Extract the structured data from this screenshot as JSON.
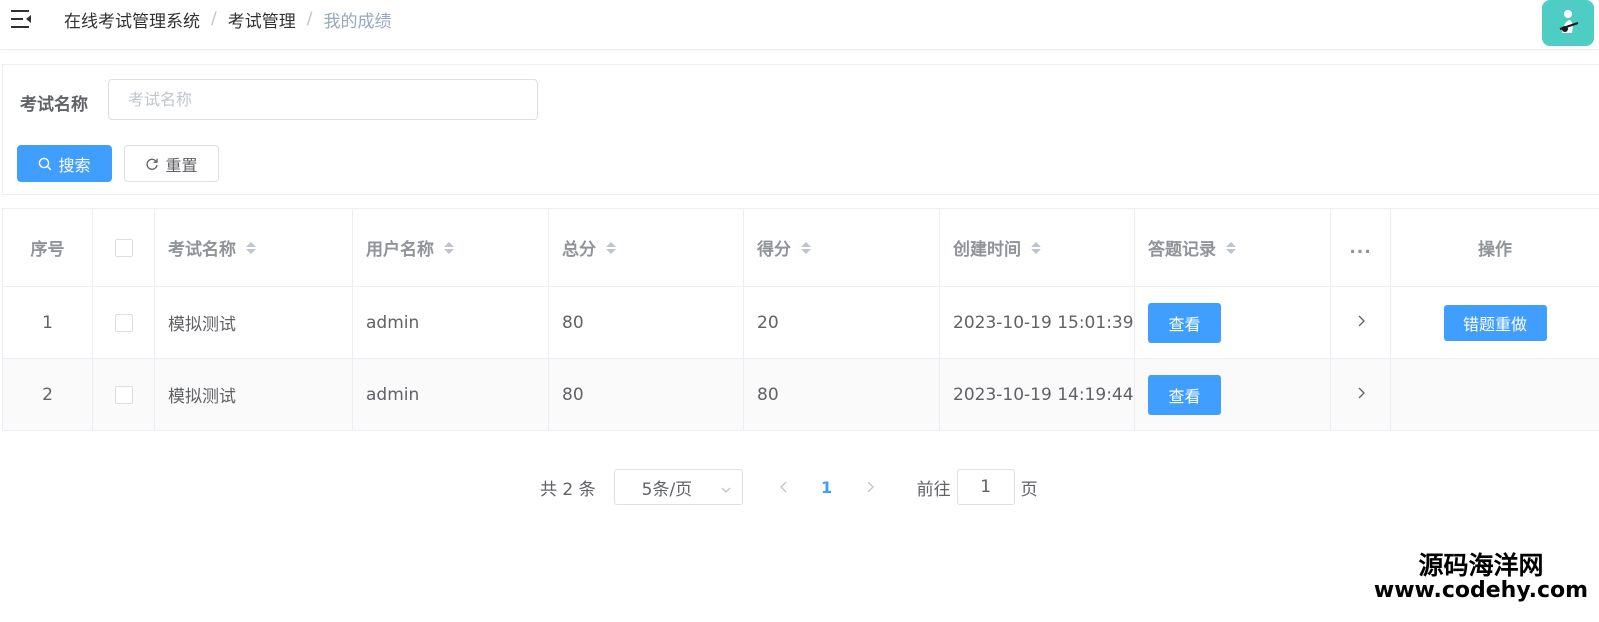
{
  "header": {
    "breadcrumb": [
      "在线考试管理系统",
      "考试管理",
      "我的成绩"
    ],
    "separator": "/"
  },
  "search": {
    "label": "考试名称",
    "placeholder": "考试名称",
    "value": "",
    "search_button": "搜索",
    "reset_button": "重置"
  },
  "table": {
    "columns": [
      "序号",
      "考试名称",
      "用户名称",
      "总分",
      "得分",
      "创建时间",
      "答题记录",
      "...",
      "操作"
    ],
    "rows": [
      {
        "index": "1",
        "exam_name": "模拟测试",
        "user_name": "admin",
        "total": "80",
        "score": "20",
        "created": "2023-10-19 15:01:39",
        "record_button": "查看",
        "action_button": "错题重做"
      },
      {
        "index": "2",
        "exam_name": "模拟测试",
        "user_name": "admin",
        "total": "80",
        "score": "80",
        "created": "2023-10-19 14:19:44",
        "record_button": "查看"
      }
    ]
  },
  "pagination": {
    "total_text": "共 2 条",
    "page_size": "5条/页",
    "current_page": "1",
    "goto_prefix": "前往",
    "goto_value": "1",
    "goto_suffix": "页"
  },
  "watermark": {
    "line1": "源码海洋网",
    "line2": "www.codehy.com"
  },
  "colors": {
    "primary": "#409eff",
    "avatar_bg": "#4ecdc4"
  }
}
